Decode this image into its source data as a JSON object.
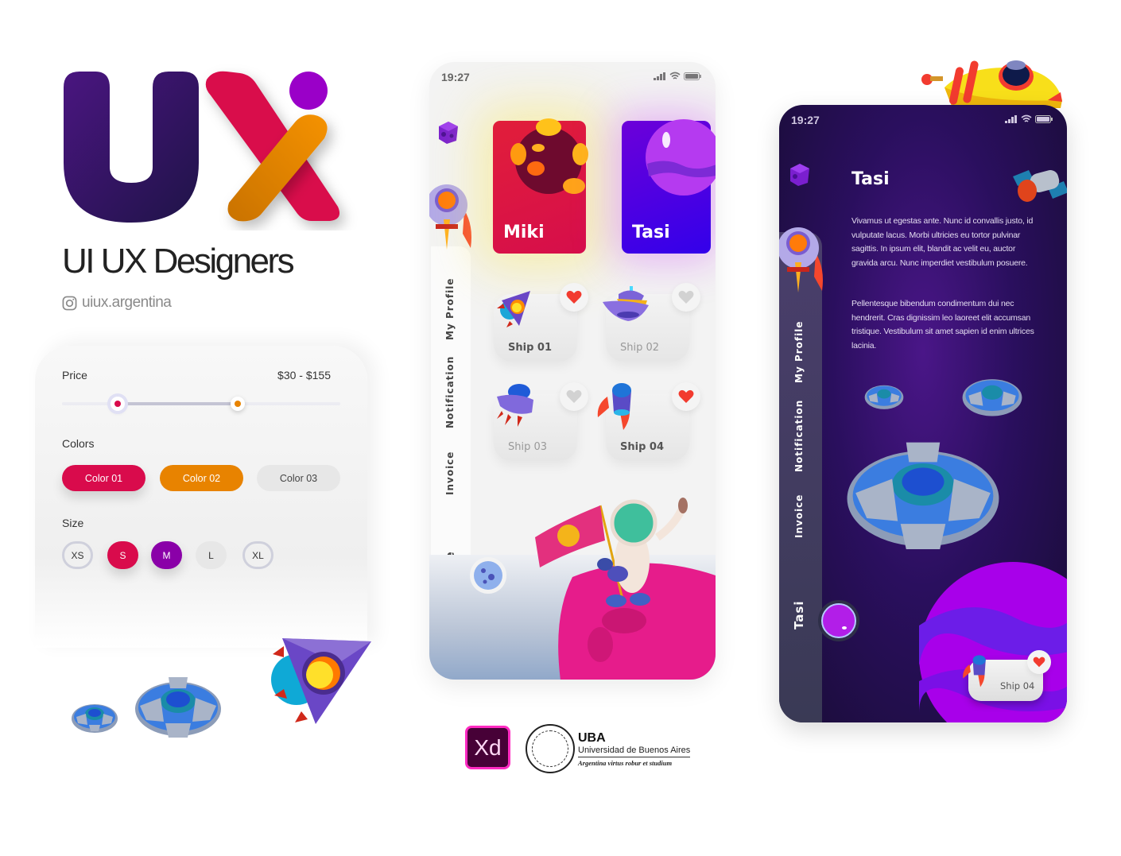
{
  "brand": {
    "logo_letters": "UX",
    "title": "UI UX Designers",
    "instagram_handle": "uiux.argentina",
    "colors": {
      "u_purple": "#3a1466",
      "x_red": "#d90b4c",
      "x_orange": "#e88300",
      "dot_purple": "#9a00c8"
    }
  },
  "filter": {
    "price_label": "Price",
    "price_range": "$30 - $155",
    "slider": {
      "min_fraction": 0.2,
      "max_fraction": 0.63,
      "min_color": "#d90b4c",
      "max_color": "#e88300"
    },
    "colors_label": "Colors",
    "color_options": [
      {
        "label": "Color 01",
        "color": "#d90b4c"
      },
      {
        "label": "Color 02",
        "color": "#e88300"
      },
      {
        "label": "Color 03",
        "color": "#e7e7e7"
      }
    ],
    "size_label": "Size",
    "sizes": [
      {
        "label": "XS",
        "state": "outline"
      },
      {
        "label": "S",
        "state": "selected-red"
      },
      {
        "label": "M",
        "state": "selected-purple"
      },
      {
        "label": "L",
        "state": "soft"
      },
      {
        "label": "XL",
        "state": "outline"
      }
    ]
  },
  "light_phone": {
    "time": "19:27",
    "nav": [
      "My Profile",
      "Notification",
      "Invoice",
      "Home"
    ],
    "cards": [
      {
        "name": "Miki",
        "icon": "planet-lava-icon"
      },
      {
        "name": "Tasi",
        "icon": "planet-purple-icon"
      }
    ],
    "ships": [
      {
        "label": "Ship 01",
        "favorite": true,
        "icon": "rocket-icon"
      },
      {
        "label": "Ship 02",
        "favorite": false,
        "icon": "ufo-saucer-icon"
      },
      {
        "label": "Ship 03",
        "favorite": false,
        "icon": "ufo-legs-icon"
      },
      {
        "label": "Ship 04",
        "favorite": true,
        "icon": "rocket-capsule-icon"
      }
    ]
  },
  "dark_phone": {
    "time": "19:27",
    "title": "Tasi",
    "paragraphs": [
      "Vivamus ut egestas ante. Nunc id convallis justo, id vulputate lacus. Morbi ultricies eu tortor pulvinar sagittis. In ipsum elit, blandit ac velit eu, auctor gravida arcu. Nunc imperdiet vestibulum posuere.",
      "Pellentesque bibendum condimentum dui nec hendrerit. Cras dignissim leo laoreet elit accumsan tristique. Vestibulum sit amet sapien id enim ultrices lacinia."
    ],
    "nav": [
      "My Profile",
      "Notification",
      "Invoice",
      "Tasi"
    ],
    "mini_card": {
      "label": "Ship 04",
      "favorite": true
    }
  },
  "footer": {
    "xd_label": "Xd",
    "uba_abbr": "UBA",
    "uba_name": "Universidad de Buenos Aires",
    "uba_motto": "Argentina virtus robur et studium"
  }
}
